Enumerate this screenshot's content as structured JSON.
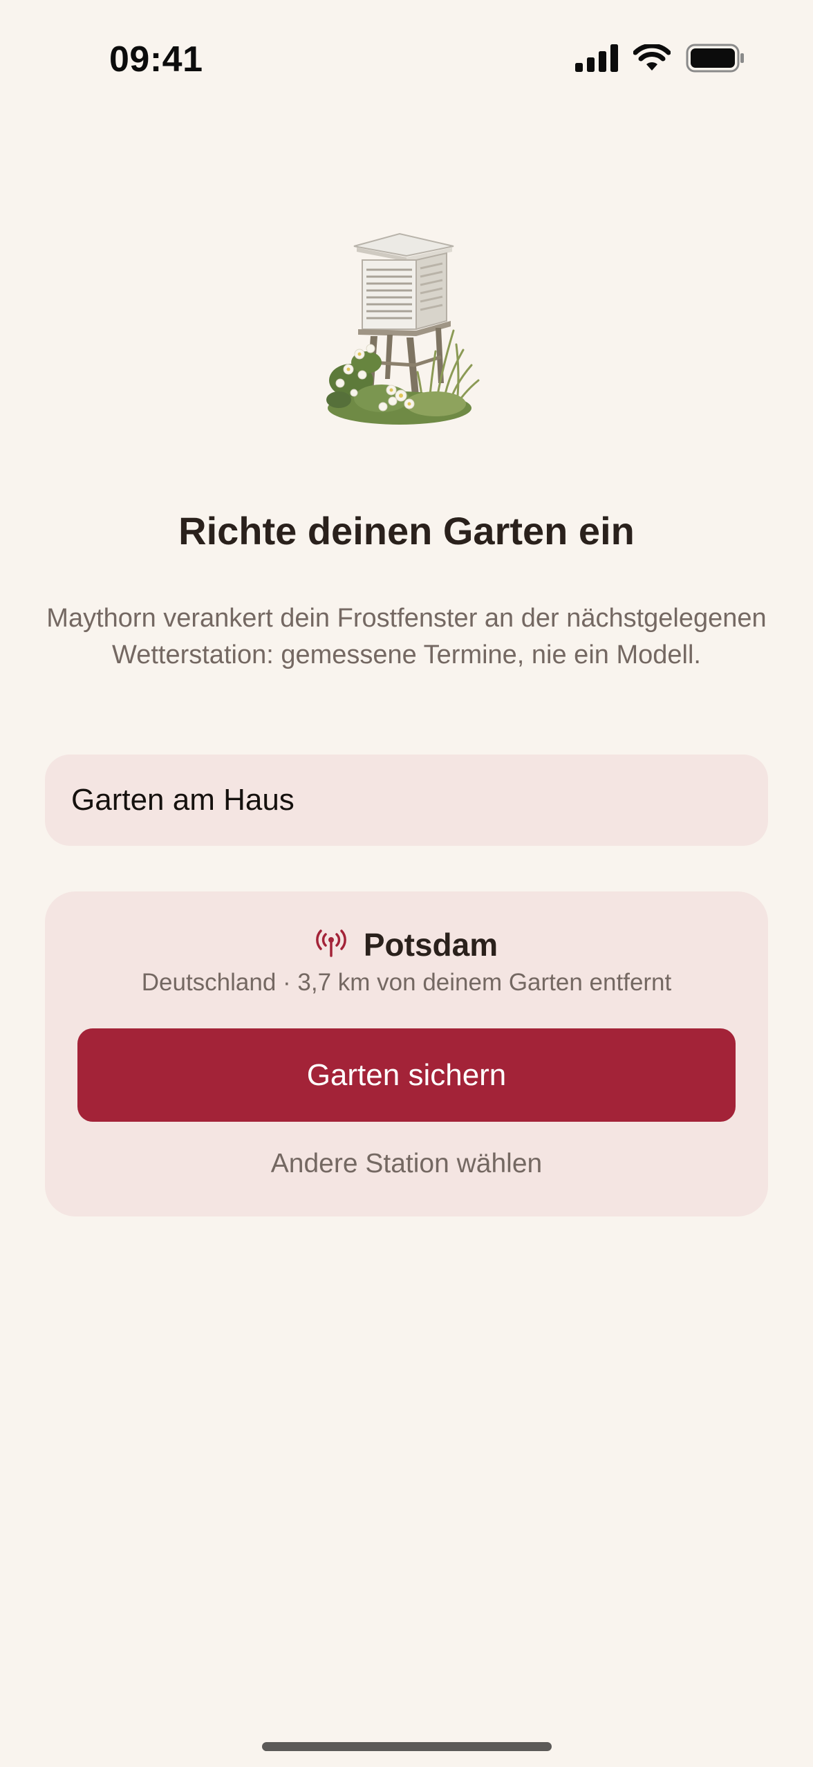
{
  "status_bar": {
    "time": "09:41"
  },
  "hero": {
    "icon": "weather-station-illustration"
  },
  "title": "Richte deinen Garten ein",
  "subtitle": "Maythorn verankert dein Frostfenster an der nächstgelegenen Wetterstation: gemessene Termine, nie ein Modell.",
  "garden_name_field": {
    "value": "Garten am Haus"
  },
  "station": {
    "icon": "antenna-icon",
    "name": "Potsdam",
    "meta": "Deutschland · 3,7 km von deinem Garten entfernt",
    "primary_button_label": "Garten sichern",
    "secondary_link_label": "Andere Station wählen"
  },
  "colors": {
    "background": "#f9f4ee",
    "card": "#f4e5e2",
    "accent": "#a32338",
    "text_primary": "#2a211c",
    "text_secondary": "#746862"
  }
}
